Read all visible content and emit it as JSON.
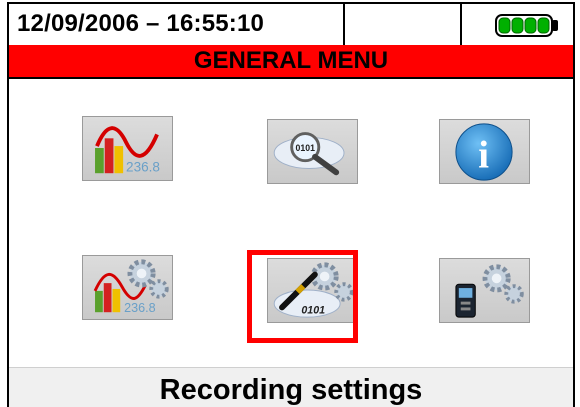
{
  "status_bar": {
    "datetime": "12/09/2006 – 16:55:10",
    "battery_icon": "battery-full-icon",
    "battery_color": "#00b000"
  },
  "menu": {
    "title": "GENERAL MENU",
    "title_bg": "#ff0000"
  },
  "icons": [
    {
      "name": "analysis-results",
      "icon": "bar-chart-sine-value-icon",
      "value_text": "236.8",
      "selected": false
    },
    {
      "name": "memory-data",
      "icon": "data-magnifier-icon",
      "value_text": "0101",
      "selected": false
    },
    {
      "name": "info",
      "icon": "info-icon",
      "value_text": "i",
      "selected": false
    },
    {
      "name": "analyzer-settings",
      "icon": "chart-gears-icon",
      "value_text": "236.8",
      "selected": false
    },
    {
      "name": "recording-settings",
      "icon": "pen-gears-icon",
      "value_text": "0101",
      "selected": true
    },
    {
      "name": "general-settings",
      "icon": "instrument-gears-icon",
      "value_text": "",
      "selected": false
    }
  ],
  "footer": {
    "label": "Recording settings"
  },
  "selection_color": "#ff0000"
}
